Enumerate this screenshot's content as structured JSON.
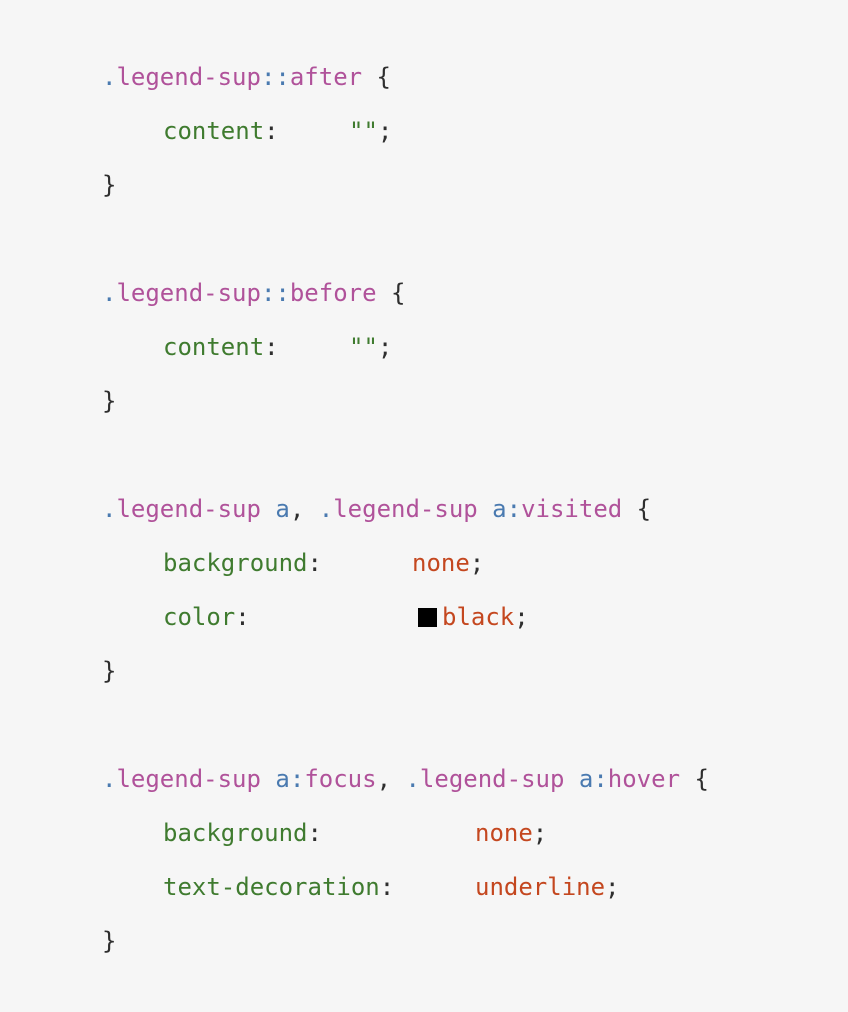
{
  "rules": [
    {
      "selector": {
        "dot": ".",
        "name": "legend-sup",
        "sep": "::",
        "pseudo": "after",
        "open": " {"
      },
      "declarations": [
        {
          "property": "content",
          "colon": ":",
          "value": "\"\"",
          "semicolon": ";"
        }
      ],
      "close": "}"
    },
    {
      "selector": {
        "dot": ".",
        "name": "legend-sup",
        "sep": "::",
        "pseudo": "before",
        "open": " {"
      },
      "declarations": [
        {
          "property": "content",
          "colon": ":",
          "value": "\"\"",
          "semicolon": ";"
        }
      ],
      "close": "}"
    },
    {
      "selector": {
        "a_dot": ".",
        "a_name": "legend-sup",
        "a_el": " a",
        "comma": ", ",
        "b_dot": ".",
        "b_name": "legend-sup",
        "b_el": " a",
        "b_colon": ":",
        "b_pseudo": "visited",
        "open": " {"
      },
      "declarations": [
        {
          "property": "background",
          "colon": ":",
          "value": "none",
          "semicolon": ";"
        },
        {
          "property": "color",
          "colon": ":",
          "value": "black",
          "semicolon": ";",
          "swatch_color": "#000000"
        }
      ],
      "close": "}"
    },
    {
      "selector": {
        "a_dot": ".",
        "a_name": "legend-sup",
        "a_el": " a",
        "a_colon": ":",
        "a_pseudo": "focus",
        "comma": ", ",
        "b_dot": ".",
        "b_name": "legend-sup",
        "b_el": " a",
        "b_colon": ":",
        "b_pseudo": "hover",
        "open": " {"
      },
      "declarations": [
        {
          "property": "background",
          "colon": ":",
          "value": "none",
          "semicolon": ";"
        },
        {
          "property": "text-decoration",
          "colon": ":",
          "value": "underline",
          "semicolon": ";"
        }
      ],
      "close": "}"
    }
  ],
  "colors": {
    "background": "#f6f6f6",
    "selector_dot": "#4a7ab0",
    "selector_name": "#b0529a",
    "property": "#3f7b2f",
    "keyword_value": "#c4471f",
    "punctuation": "#2e2e2e"
  }
}
